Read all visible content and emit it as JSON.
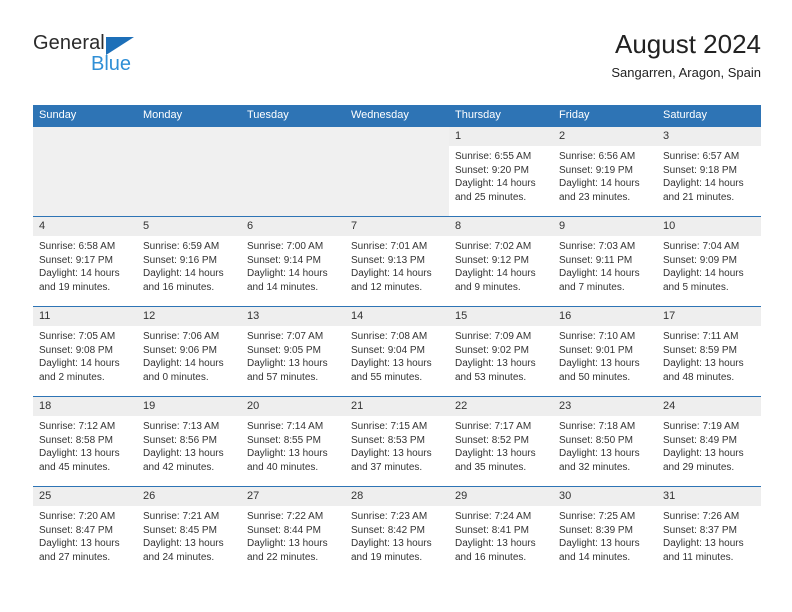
{
  "brand": {
    "name_top": "General",
    "name_bottom": "Blue",
    "triangle_color": "#1d6fb8",
    "blue_color": "#2f8fd6"
  },
  "header": {
    "title": "August 2024",
    "subtitle": "Sangarren, Aragon, Spain"
  },
  "theme": {
    "header_blue": "#2e74b5",
    "daynum_band": "#eeeeee",
    "empty_cell": "#f0f0f0",
    "text": "#333333"
  },
  "calendar": {
    "weekday_headers": [
      "Sunday",
      "Monday",
      "Tuesday",
      "Wednesday",
      "Thursday",
      "Friday",
      "Saturday"
    ],
    "weeks": [
      [
        {
          "empty": true
        },
        {
          "empty": true
        },
        {
          "empty": true
        },
        {
          "empty": true
        },
        {
          "day": "1",
          "sunrise": "Sunrise: 6:55 AM",
          "sunset": "Sunset: 9:20 PM",
          "daylight1": "Daylight: 14 hours",
          "daylight2": "and 25 minutes."
        },
        {
          "day": "2",
          "sunrise": "Sunrise: 6:56 AM",
          "sunset": "Sunset: 9:19 PM",
          "daylight1": "Daylight: 14 hours",
          "daylight2": "and 23 minutes."
        },
        {
          "day": "3",
          "sunrise": "Sunrise: 6:57 AM",
          "sunset": "Sunset: 9:18 PM",
          "daylight1": "Daylight: 14 hours",
          "daylight2": "and 21 minutes."
        }
      ],
      [
        {
          "day": "4",
          "sunrise": "Sunrise: 6:58 AM",
          "sunset": "Sunset: 9:17 PM",
          "daylight1": "Daylight: 14 hours",
          "daylight2": "and 19 minutes."
        },
        {
          "day": "5",
          "sunrise": "Sunrise: 6:59 AM",
          "sunset": "Sunset: 9:16 PM",
          "daylight1": "Daylight: 14 hours",
          "daylight2": "and 16 minutes."
        },
        {
          "day": "6",
          "sunrise": "Sunrise: 7:00 AM",
          "sunset": "Sunset: 9:14 PM",
          "daylight1": "Daylight: 14 hours",
          "daylight2": "and 14 minutes."
        },
        {
          "day": "7",
          "sunrise": "Sunrise: 7:01 AM",
          "sunset": "Sunset: 9:13 PM",
          "daylight1": "Daylight: 14 hours",
          "daylight2": "and 12 minutes."
        },
        {
          "day": "8",
          "sunrise": "Sunrise: 7:02 AM",
          "sunset": "Sunset: 9:12 PM",
          "daylight1": "Daylight: 14 hours",
          "daylight2": "and 9 minutes."
        },
        {
          "day": "9",
          "sunrise": "Sunrise: 7:03 AM",
          "sunset": "Sunset: 9:11 PM",
          "daylight1": "Daylight: 14 hours",
          "daylight2": "and 7 minutes."
        },
        {
          "day": "10",
          "sunrise": "Sunrise: 7:04 AM",
          "sunset": "Sunset: 9:09 PM",
          "daylight1": "Daylight: 14 hours",
          "daylight2": "and 5 minutes."
        }
      ],
      [
        {
          "day": "11",
          "sunrise": "Sunrise: 7:05 AM",
          "sunset": "Sunset: 9:08 PM",
          "daylight1": "Daylight: 14 hours",
          "daylight2": "and 2 minutes."
        },
        {
          "day": "12",
          "sunrise": "Sunrise: 7:06 AM",
          "sunset": "Sunset: 9:06 PM",
          "daylight1": "Daylight: 14 hours",
          "daylight2": "and 0 minutes."
        },
        {
          "day": "13",
          "sunrise": "Sunrise: 7:07 AM",
          "sunset": "Sunset: 9:05 PM",
          "daylight1": "Daylight: 13 hours",
          "daylight2": "and 57 minutes."
        },
        {
          "day": "14",
          "sunrise": "Sunrise: 7:08 AM",
          "sunset": "Sunset: 9:04 PM",
          "daylight1": "Daylight: 13 hours",
          "daylight2": "and 55 minutes."
        },
        {
          "day": "15",
          "sunrise": "Sunrise: 7:09 AM",
          "sunset": "Sunset: 9:02 PM",
          "daylight1": "Daylight: 13 hours",
          "daylight2": "and 53 minutes."
        },
        {
          "day": "16",
          "sunrise": "Sunrise: 7:10 AM",
          "sunset": "Sunset: 9:01 PM",
          "daylight1": "Daylight: 13 hours",
          "daylight2": "and 50 minutes."
        },
        {
          "day": "17",
          "sunrise": "Sunrise: 7:11 AM",
          "sunset": "Sunset: 8:59 PM",
          "daylight1": "Daylight: 13 hours",
          "daylight2": "and 48 minutes."
        }
      ],
      [
        {
          "day": "18",
          "sunrise": "Sunrise: 7:12 AM",
          "sunset": "Sunset: 8:58 PM",
          "daylight1": "Daylight: 13 hours",
          "daylight2": "and 45 minutes."
        },
        {
          "day": "19",
          "sunrise": "Sunrise: 7:13 AM",
          "sunset": "Sunset: 8:56 PM",
          "daylight1": "Daylight: 13 hours",
          "daylight2": "and 42 minutes."
        },
        {
          "day": "20",
          "sunrise": "Sunrise: 7:14 AM",
          "sunset": "Sunset: 8:55 PM",
          "daylight1": "Daylight: 13 hours",
          "daylight2": "and 40 minutes."
        },
        {
          "day": "21",
          "sunrise": "Sunrise: 7:15 AM",
          "sunset": "Sunset: 8:53 PM",
          "daylight1": "Daylight: 13 hours",
          "daylight2": "and 37 minutes."
        },
        {
          "day": "22",
          "sunrise": "Sunrise: 7:17 AM",
          "sunset": "Sunset: 8:52 PM",
          "daylight1": "Daylight: 13 hours",
          "daylight2": "and 35 minutes."
        },
        {
          "day": "23",
          "sunrise": "Sunrise: 7:18 AM",
          "sunset": "Sunset: 8:50 PM",
          "daylight1": "Daylight: 13 hours",
          "daylight2": "and 32 minutes."
        },
        {
          "day": "24",
          "sunrise": "Sunrise: 7:19 AM",
          "sunset": "Sunset: 8:49 PM",
          "daylight1": "Daylight: 13 hours",
          "daylight2": "and 29 minutes."
        }
      ],
      [
        {
          "day": "25",
          "sunrise": "Sunrise: 7:20 AM",
          "sunset": "Sunset: 8:47 PM",
          "daylight1": "Daylight: 13 hours",
          "daylight2": "and 27 minutes."
        },
        {
          "day": "26",
          "sunrise": "Sunrise: 7:21 AM",
          "sunset": "Sunset: 8:45 PM",
          "daylight1": "Daylight: 13 hours",
          "daylight2": "and 24 minutes."
        },
        {
          "day": "27",
          "sunrise": "Sunrise: 7:22 AM",
          "sunset": "Sunset: 8:44 PM",
          "daylight1": "Daylight: 13 hours",
          "daylight2": "and 22 minutes."
        },
        {
          "day": "28",
          "sunrise": "Sunrise: 7:23 AM",
          "sunset": "Sunset: 8:42 PM",
          "daylight1": "Daylight: 13 hours",
          "daylight2": "and 19 minutes."
        },
        {
          "day": "29",
          "sunrise": "Sunrise: 7:24 AM",
          "sunset": "Sunset: 8:41 PM",
          "daylight1": "Daylight: 13 hours",
          "daylight2": "and 16 minutes."
        },
        {
          "day": "30",
          "sunrise": "Sunrise: 7:25 AM",
          "sunset": "Sunset: 8:39 PM",
          "daylight1": "Daylight: 13 hours",
          "daylight2": "and 14 minutes."
        },
        {
          "day": "31",
          "sunrise": "Sunrise: 7:26 AM",
          "sunset": "Sunset: 8:37 PM",
          "daylight1": "Daylight: 13 hours",
          "daylight2": "and 11 minutes."
        }
      ]
    ]
  }
}
